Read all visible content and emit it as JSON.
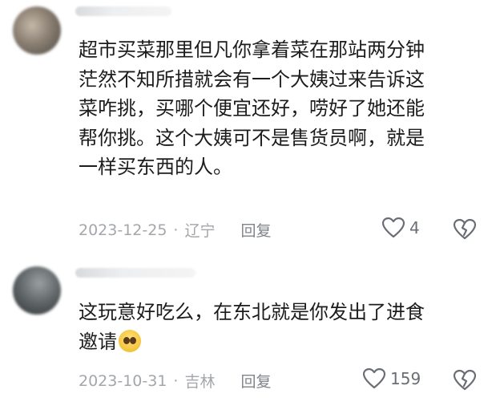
{
  "comments": [
    {
      "lines": [
        "超市买菜那里但凡你拿着菜在那站两分钟",
        "茫然不知所措就会有一个大姨过来告诉这",
        "菜咋挑，买哪个便宜还好，唠好了她还能",
        "帮你挑。这个大姨可不是售货员啊，就是",
        "一样买东西的人。"
      ],
      "date": "2023-12-25",
      "separator": "·",
      "location": "辽宁",
      "reply_label": "回复",
      "like_count": "4"
    },
    {
      "lines": [
        "这玩意好吃么，在东北就是你发出了进食",
        "邀请"
      ],
      "emoji": "pleading-face-emoji",
      "date": "2023-10-31",
      "separator": "·",
      "location": "吉林",
      "reply_label": "回复",
      "like_count": "159"
    }
  ],
  "icons": {
    "like": "heart-outline-icon",
    "dislike": "broken-heart-icon"
  },
  "colors": {
    "text": "#1c1c1c",
    "meta": "#a3a6ab",
    "icon": "#6a6e74"
  }
}
